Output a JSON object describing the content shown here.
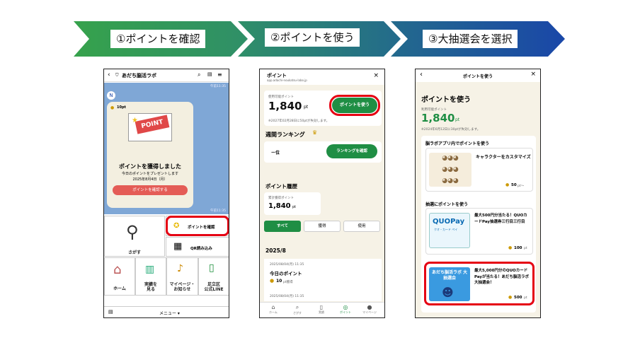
{
  "steps": [
    {
      "label": "①ポイントを確認"
    },
    {
      "label": "②ポイントを使う"
    },
    {
      "label": "③大抽選会を選択"
    }
  ],
  "phone1": {
    "title": "あだち脳活ラボ",
    "time1": "午前11:35",
    "time2": "午前11:35",
    "points_badge": "10pt",
    "envelope_word": "POINT",
    "heading": "ポイントを獲得しました",
    "sub1": "今日のポイントをプレゼントします",
    "date": "2025年8月4日（月）",
    "confirm_btn": "ポイントを確認する",
    "menu": {
      "search": "さがす",
      "point_check": "ポイントを確認",
      "qr": "QR読み込み",
      "home": "ホーム",
      "results": "実績を\n見る",
      "mypage": "マイページ・\nお知らせ",
      "line": "足立区\n公式LINE"
    },
    "footer": "メニュー ▾"
  },
  "phone2": {
    "title": "ポイント",
    "url": "app.adachi-noukatsu-labo.jp",
    "avail_label": "使用可能ポイント",
    "points": "1,840",
    "unit": "pt",
    "use_btn": "ポイントを使う",
    "expire": "※2027年02月28日に50ptが失効します。",
    "ranking_title": "週間ランキング",
    "rank_value": "ー位",
    "rank_btn": "ランキングを確認",
    "history_title": "ポイント履歴",
    "total_label": "累計獲得ポイント",
    "total_points": "1,840",
    "filters": [
      "すべて",
      "獲得",
      "使用"
    ],
    "month": "2025/8",
    "entry_date": "2025/08/04(月) 11:35",
    "entry_title": "今日のポイント",
    "entry_pts": "10",
    "entry_unit": "pt獲得",
    "entry_date2": "2025/08/04(月) 11:35",
    "tabs": [
      "ホーム",
      "さがす",
      "実績",
      "ポイント",
      "マイページ"
    ]
  },
  "phone3": {
    "header": "ポイントを使う",
    "title": "ポイントを使う",
    "avail_label": "利用可能ポイント",
    "points": "1,840",
    "unit": "pt",
    "expire": "※2024年6月12日に30ptが失効します。",
    "section1": "脳ラボアプリ内でポイントを使う",
    "char_title": "キャラクターをカスタマイズ",
    "char_pts": "50",
    "char_unit": "pt～",
    "section2": "抽選にポイントを使う",
    "quo_logo": "QUOPay",
    "quo_sub": "クオ・カード ペイ",
    "quo_title": "最大500円分当たる！QUOカードPay抽選券三行目三行目",
    "quo_pts": "100",
    "quo_unit": "pt",
    "lottery_img_text": "あだち脳活ラボ 大抽選会",
    "lottery_title": "最大5,000円分のQUOカードPayが当たる！あだち脳活ラボ大抽選会！",
    "lottery_pts": "500",
    "lottery_unit": "pt"
  }
}
